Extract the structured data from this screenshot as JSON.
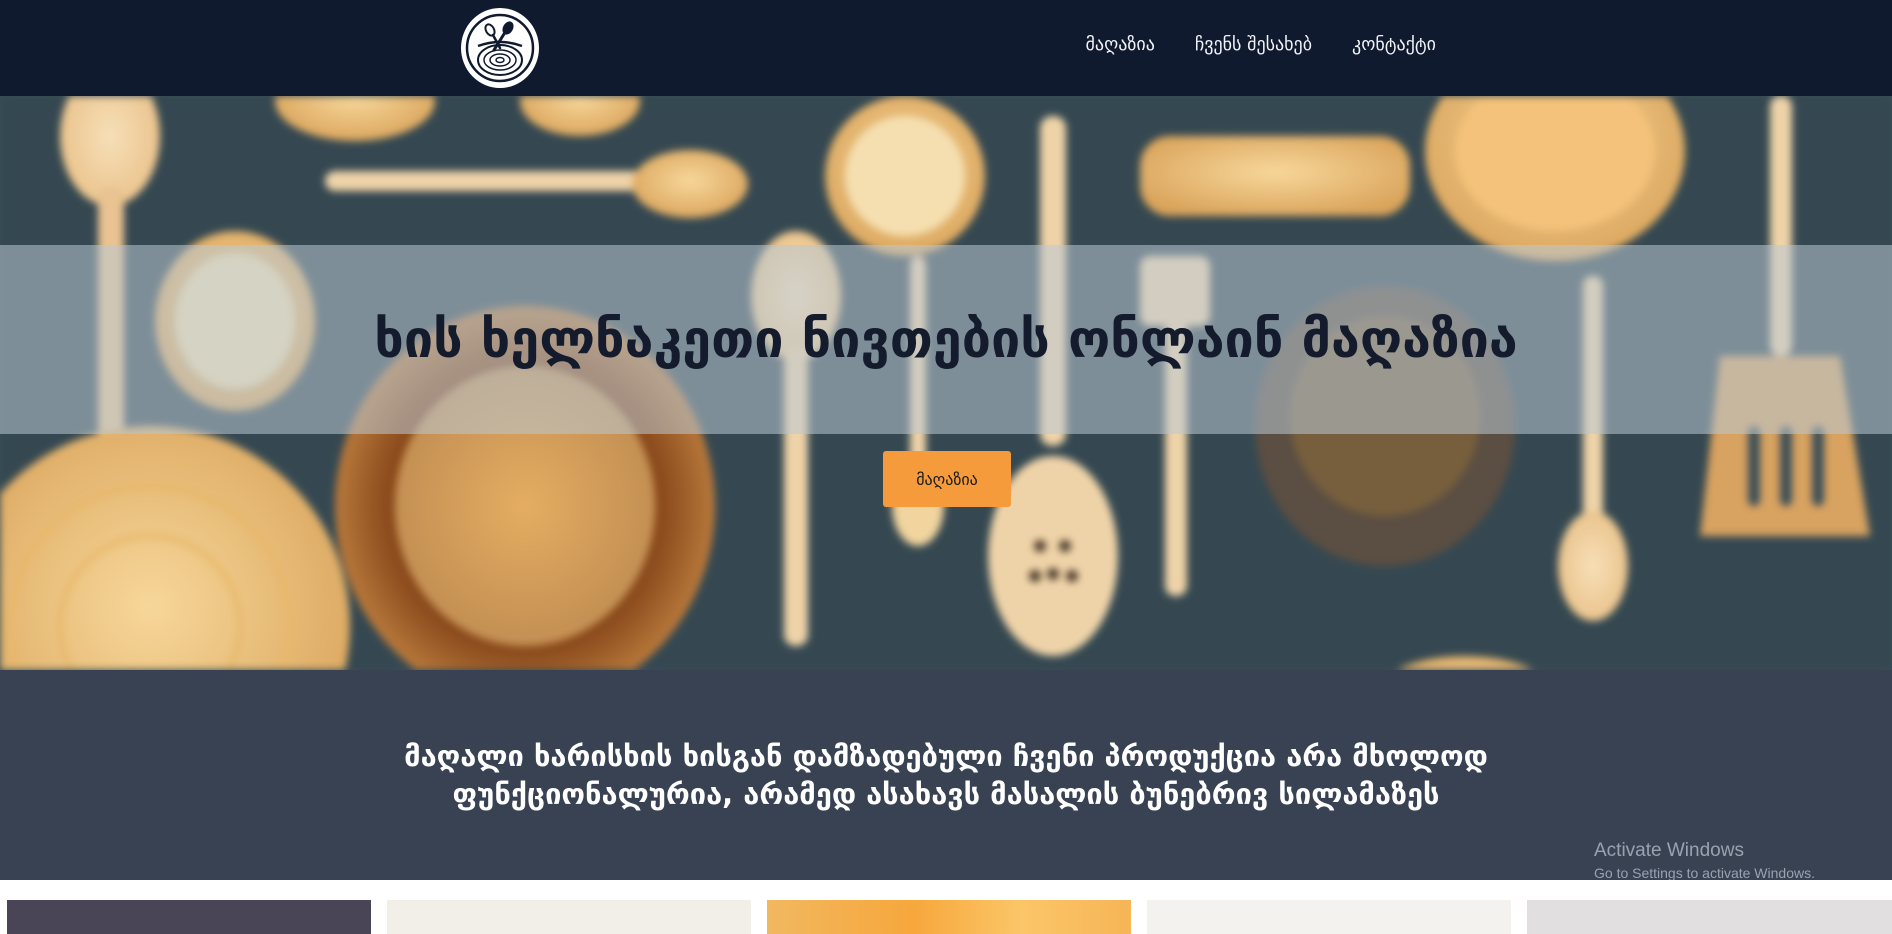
{
  "nav": {
    "logo_icon": "wood-bowl-spoon-logo-icon",
    "links": [
      {
        "label": "მაღაზია"
      },
      {
        "label": "ჩვენს შესახებ"
      },
      {
        "label": "კონტაქტი"
      }
    ]
  },
  "hero": {
    "title": "ხის ხელნაკეთი ნივთების ონლაინ მაღაზია",
    "button_label": "მაღაზია",
    "accent_color": "#f59b3c"
  },
  "tagline": {
    "line1": "მაღალი ხარისხის ხისგან დამზადებული ჩვენი პროდუქცია არა მხოლოდ",
    "line2": "ფუნქციონალურია, არამედ ასახავს მასალის ბუნებრივ სილამაზეს"
  },
  "watermark": {
    "title": "Activate Windows",
    "subtitle": "Go to Settings to activate Windows."
  },
  "colors": {
    "navbar": "#101a2e",
    "tagline_bg": "#394253",
    "hero_bg": "#3a4e57"
  }
}
